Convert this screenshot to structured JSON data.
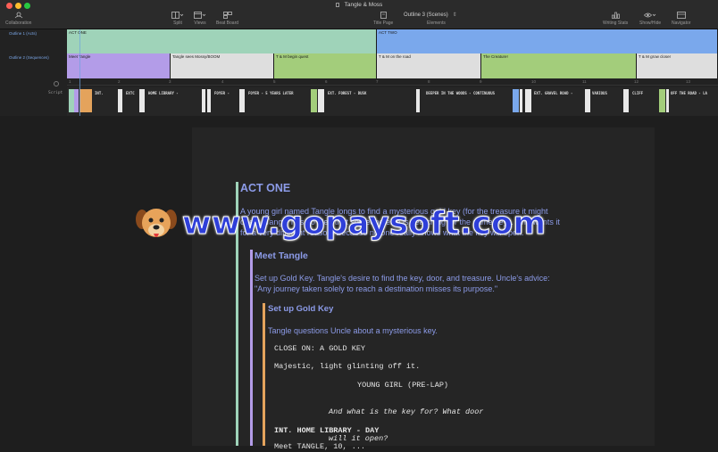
{
  "window": {
    "title": "Tangle & Moss"
  },
  "toolbar": {
    "collaboration": "Collaboration",
    "split": "Split",
    "views": "Views",
    "beat_board": "Beat Board",
    "title_page": "Title Page",
    "elements": "Elements",
    "outline_select": "Outline 3 (Scenes)",
    "writing_stats": "Writing Stats",
    "show_hide": "Show/Hide",
    "navigator": "Navigator"
  },
  "outline": {
    "row1_label": "Outline 1 (Acts)",
    "row2_label": "Outline 2 (Sequences)",
    "acts": [
      {
        "label": "ACT ONE",
        "color": "#9fd3b9"
      },
      {
        "label": "ACT TWO",
        "color": "#7aa8ec"
      }
    ],
    "sequences": [
      {
        "label": "Meet Tangle",
        "color": "#b39ce8"
      },
      {
        "label": "Tangle sees Mossy/BOOM",
        "color": "#dedede"
      },
      {
        "label": "T & M begin quest",
        "color": "#a3cd7b"
      },
      {
        "label": "T & M on the road",
        "color": "#dedede"
      },
      {
        "label": "The Creature!",
        "color": "#a3cd7b"
      },
      {
        "label": "T & M grow closer",
        "color": "#dedede"
      }
    ],
    "ruler": [
      "1",
      "2",
      "3",
      "4",
      "5",
      "6",
      "7",
      "8",
      "9",
      "10",
      "11",
      "12",
      "13"
    ]
  },
  "script_track": {
    "label": "Script",
    "slugs": [
      "INT.",
      "EXTC",
      "HOME LIBRARY -",
      "FOYER -",
      "FOYER - 5 YEARS LATER",
      "EXT. FOREST - DUSK",
      "DEEPER IN THE WOODS - CONTINUOUS",
      "EXT. GRAVEL ROAD -",
      "VARIOUS",
      "CLIFF",
      "OFF THE ROAD - LA"
    ]
  },
  "editor": {
    "act_heading": "ACT ONE",
    "act_desc": [
      "A young girl named Tangle longs to find a mysterious gold key (for the treasure it might",
      "open). Tangle has no idea that someone else is searching for the same key... who wants it",
      "for a very different reason. Because no one really knows what the key will open."
    ],
    "seq_heading": "Meet Tangle",
    "seq_desc": [
      "Set up Gold Key. Tangle's desire to find the key, door, and treasure. Uncle's advice:",
      "\"Any journey taken solely to reach a destination misses its purpose.\""
    ],
    "scene_heading": "Set up Gold Key",
    "scene_desc": "Tangle questions Uncle about a mysterious key.",
    "screenplay": {
      "transition": "CLOSE ON: A GOLD KEY",
      "action": "Majestic, light glinting off it.",
      "character": "YOUNG GIRL (PRE-LAP)",
      "dialogue": [
        "And what is the key for? What door",
        "will it open?"
      ],
      "slugline": "INT. HOME LIBRARY - DAY",
      "next_line": "Meet TANGLE, 10, ..."
    }
  },
  "watermark": {
    "text": "www.gopaysoft.com"
  },
  "colors": {
    "accent_text": "#8c9be8",
    "act_bar": "#9fd3b9",
    "seq_bar": "#b39ce8",
    "scene_bar": "#e4a35c"
  }
}
